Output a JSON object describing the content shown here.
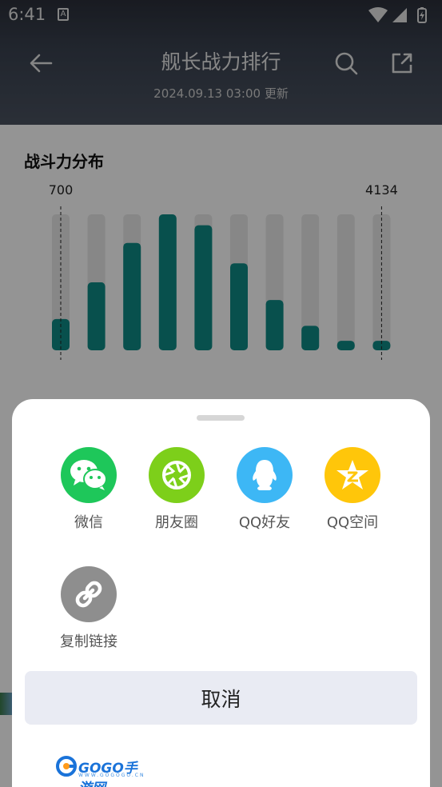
{
  "status_bar": {
    "time": "6:41",
    "notification_letter": "A"
  },
  "header": {
    "title": "舰长战力排行",
    "subtitle": "2024.09.13 03:00 更新"
  },
  "section": {
    "title": "战斗力分布"
  },
  "chart_data": {
    "type": "bar",
    "title": "",
    "xlabel": "",
    "ylabel": "",
    "annotations": [
      {
        "label": "700",
        "bar_index": 0
      },
      {
        "label": "4134",
        "bar_index": 9
      }
    ],
    "values": [
      0.23,
      0.5,
      0.79,
      1.0,
      0.92,
      0.64,
      0.37,
      0.18,
      0.07,
      0.07
    ],
    "ylim": [
      0,
      1
    ],
    "colors": {
      "bar": "#0f8a86",
      "track": "#e8e8e8"
    }
  },
  "share_sheet": {
    "items": [
      {
        "label": "微信",
        "icon": "wechat-icon",
        "color": "#1ec75a"
      },
      {
        "label": "朋友圈",
        "icon": "moments-icon",
        "color": "#7dcf1a"
      },
      {
        "label": "QQ好友",
        "icon": "qq-icon",
        "color": "#3db7f5"
      },
      {
        "label": "QQ空间",
        "icon": "qzone-icon",
        "color": "#ffc60a"
      },
      {
        "label": "复制链接",
        "icon": "link-icon",
        "color": "#8e8e8e"
      }
    ],
    "cancel_label": "取消"
  },
  "watermark": {
    "brand": "GOGO手游网",
    "url": "WWW.GOGOGO.CN"
  }
}
